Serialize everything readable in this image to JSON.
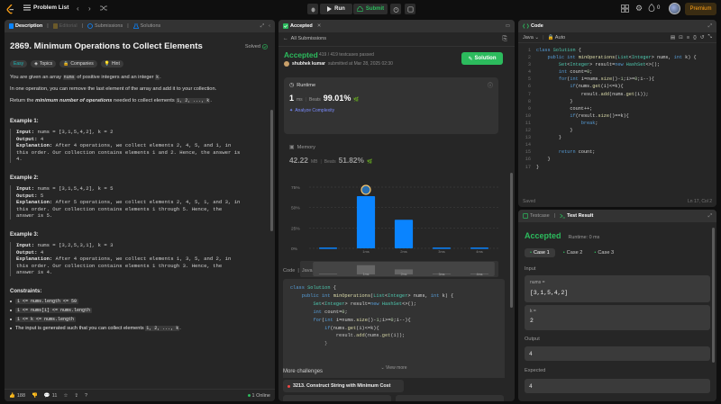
{
  "topbar": {
    "problem_list_label": "Problem List",
    "run_label": "Run",
    "submit_label": "Submit",
    "streak_count": "0",
    "premium_label": "Premium"
  },
  "left": {
    "tabs": [
      "Description",
      "Editorial",
      "Submissions",
      "Solutions"
    ],
    "title": "2869. Minimum Operations to Collect Elements",
    "solved_label": "Solved",
    "tags": [
      "Easy",
      "Topics",
      "Companies",
      "Hint"
    ],
    "intro_1a": "You are given an array ",
    "intro_1_code": "nums",
    "intro_1b": " of positive integers and an integer ",
    "intro_1_k": "k",
    "intro_1c": ".",
    "intro_2": "In one operation, you can remove the last element of the array and add it to your collection.",
    "intro_3a": "Return the ",
    "intro_3_bold": "minimum number of operations",
    "intro_3b": " needed to collect elements ",
    "intro_3_code": "1, 2, ..., k",
    "intro_3c": ".",
    "examples": [
      {
        "title": "Example 1:",
        "input": "nums = [3,1,5,4,2], k = 2",
        "output": "4",
        "explanation": [
          "After 4 operations, we collect elements 2, 4, 5, and 1, in",
          "this order. Our collection contains elements 1 and 2. Hence, the answer is",
          "4."
        ]
      },
      {
        "title": "Example 2:",
        "input": "nums = [3,1,5,4,2], k = 5",
        "output": "5",
        "explanation": [
          "After 5 operations, we collect elements 2, 4, 5, 1, and 3, in",
          "this order. Our collection contains elements 1 through 5. Hence, the",
          "answer is 5."
        ]
      },
      {
        "title": "Example 3:",
        "input": "nums = [3,2,5,3,1], k = 3",
        "output": "4",
        "explanation": [
          "After 4 operations, we collect elements 1, 3, 5, and 2, in",
          "this order. Our collection contains elements 1 through 3. Hence, the",
          "answer is 4."
        ]
      }
    ],
    "input_label": "Input:",
    "output_label": "Output:",
    "explanation_label": "Explanation:",
    "constraints_title": "Constraints:",
    "constraints": [
      "1 <= nums.length <= 50",
      "1 <= nums[i] <= nums.length",
      "1 <= k <= nums.length"
    ],
    "constraint_last_a": "The input is generated such that you can collect elements ",
    "constraint_last_code": "1, 2, ..., k",
    "constraint_last_b": ".",
    "likes": "188",
    "comments": "11",
    "online": "1 Online"
  },
  "middle": {
    "tab_label": "Accepted",
    "back_label": "All Submissions",
    "status": "Accepted",
    "testcases": "419 / 419 testcases passed",
    "user": "shubhek kumar",
    "submitted_at": "submitted at Mar 28, 2025 02:30",
    "solution_btn": "Solution",
    "runtime_label": "Runtime",
    "runtime_value": "1",
    "runtime_unit": "ms",
    "beats_label": "Beats",
    "runtime_beats": "99.01%",
    "analyze_label": "Analyze Complexity",
    "memory_label": "Memory",
    "memory_value": "42.22",
    "memory_unit": "MB",
    "memory_beats": "51.82%",
    "code_header_a": "Code",
    "code_header_b": "Java",
    "view_more": "View more",
    "more_challenges": "More challenges",
    "challenge_1": "3213. Construct String with Minimum Cost"
  },
  "chart_data": {
    "type": "bar",
    "categories": [
      "1ms",
      "2ms",
      "3ms",
      "4ms"
    ],
    "values": [
      1,
      64,
      35,
      1,
      1
    ],
    "ytick_labels": [
      "75%",
      "50%",
      "25%",
      "0%"
    ],
    "ylim": [
      0,
      75
    ],
    "highlight_category": "1ms",
    "bar_color": "#0a84ff",
    "grid": true
  },
  "code": {
    "tab_label": "Code",
    "language": "Java",
    "autosave": "Auto",
    "saved_label": "Saved",
    "cursor_pos": "Ln 17, Col 2",
    "lines": [
      "class Solution {",
      "    public int minOperations(List<Integer> nums, int k) {",
      "        Set<Integer> result=new HashSet<>();",
      "        int count=0;",
      "        for(int i=nums.size()-1;i>=0;i--){",
      "            if(nums.get(i)<=k){",
      "                result.add(nums.get(i));",
      "            }",
      "            count++;",
      "            if(result.size()==k){",
      "                break;",
      "            }",
      "        }",
      "",
      "        return count;",
      "    }",
      "}"
    ]
  },
  "testpanel": {
    "tab_testcase": "Testcase",
    "tab_result": "Test Result",
    "status": "Accepted",
    "runtime": "Runtime: 0 ms",
    "cases": [
      "Case 1",
      "Case 2",
      "Case 3"
    ],
    "input_label": "Input",
    "nums_label": "nums =",
    "nums_value": "[3,1,5,4,2]",
    "k_label": "k =",
    "k_value": "2",
    "output_label": "Output",
    "output_value": "4",
    "expected_label": "Expected",
    "expected_value": "4"
  },
  "colors": {
    "accepted": "#2cbb5d",
    "easy": "#1cbaba",
    "accent_blue": "#0a84ff",
    "premium": "#ffa116"
  }
}
